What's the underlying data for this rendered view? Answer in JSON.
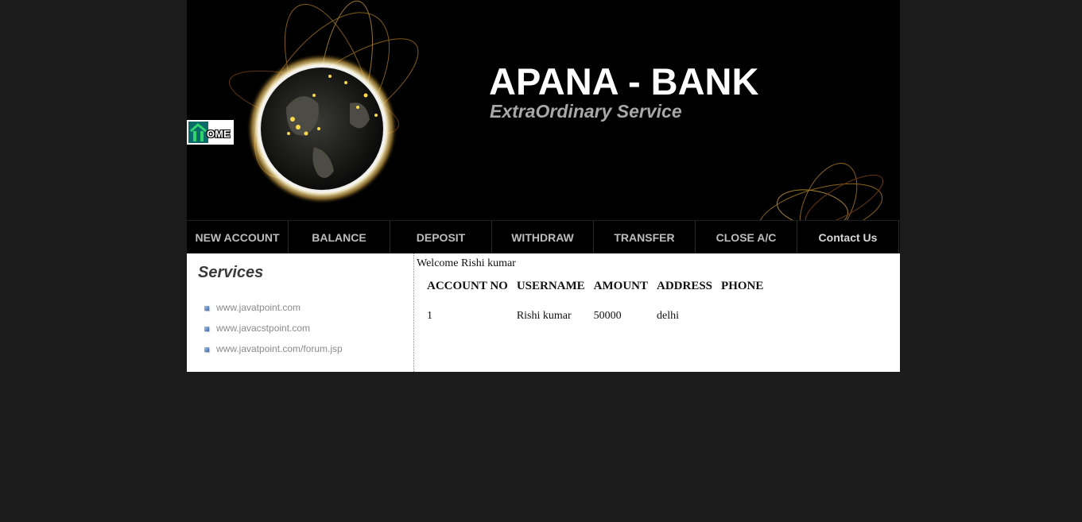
{
  "header": {
    "title": "APANA - BANK",
    "tagline": "ExtraOrdinary Service",
    "home_button_text": "OME"
  },
  "nav": {
    "items": [
      {
        "label": "NEW ACCOUNT"
      },
      {
        "label": "BALANCE"
      },
      {
        "label": "DEPOSIT"
      },
      {
        "label": "WITHDRAW"
      },
      {
        "label": "TRANSFER"
      },
      {
        "label": "CLOSE A/C"
      },
      {
        "label": "Contact Us"
      }
    ]
  },
  "sidebar": {
    "title": "Services",
    "links": [
      {
        "label": "www.javatpoint.com"
      },
      {
        "label": "www.javacstpoint.com"
      },
      {
        "label": "www.javatpoint.com/forum.jsp"
      }
    ]
  },
  "main": {
    "welcome": "Welcome Rishi kumar",
    "table": {
      "headers": [
        "ACCOUNT NO",
        "USERNAME",
        "AMOUNT",
        "ADDRESS",
        "PHONE"
      ],
      "rows": [
        [
          "1",
          "Rishi kumar",
          "50000",
          "delhi",
          ""
        ]
      ]
    }
  },
  "colors": {
    "page_bg": "#1b1b1b",
    "header_bg": "#000000",
    "nav_text": "#bdbdbd",
    "title_text": "#ffffff",
    "tagline_text": "#a8a8a8",
    "content_bg": "#ffffff"
  }
}
